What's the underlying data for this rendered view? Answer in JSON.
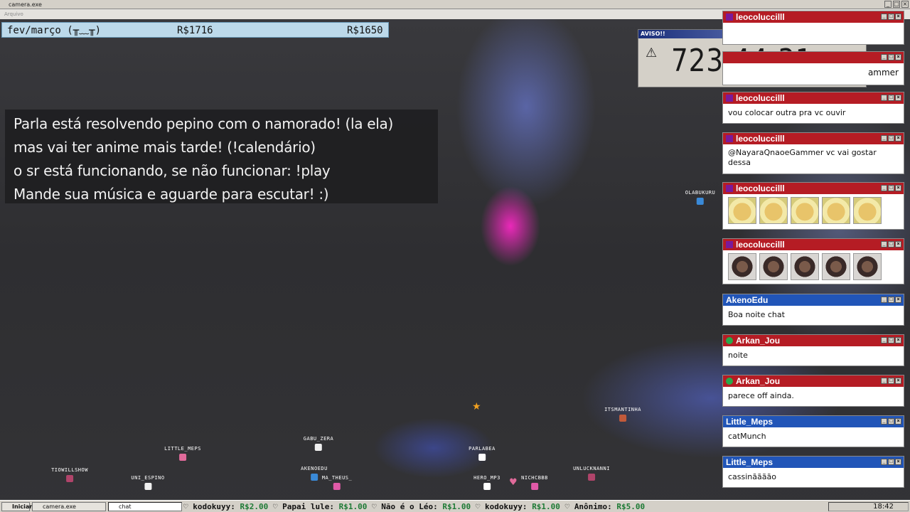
{
  "window": {
    "title": "camera.exe",
    "menu": "Arquivo"
  },
  "money_bar": {
    "label": "fev/março (╥﹏╥)",
    "value1": "R$1716",
    "value2": "R$1650"
  },
  "notice": {
    "lines": [
      "Parla está resolvendo pepino com o namorado! (la ela)",
      "mas vai ter anime mais tarde! (!calendário)",
      "o sr está funcionando, se não funcionar: !play",
      "Mande sua música e aguarde para escutar! :)"
    ]
  },
  "timer": {
    "title": "AVISO!!",
    "value": "723:44:31",
    "warn_icon": "warning-icon"
  },
  "chats": [
    {
      "user": "leocoluccilll",
      "msg": "",
      "color": "#b51c24"
    },
    {
      "user": "",
      "msg": "ammer",
      "color": "#b51c24"
    },
    {
      "user": "leocoluccilll",
      "msg": "vou colocar outra pra vc ouvir",
      "color": "#b51c24"
    },
    {
      "user": "leocoluccilll",
      "msg": "@NayaraQnaoeGammer vc vai gostar dessa",
      "color": "#b51c24"
    },
    {
      "user": "leocoluccilll",
      "emotes": "doge",
      "color": "#b51c24"
    },
    {
      "user": "leocoluccilll",
      "emotes": "face",
      "color": "#b51c24"
    },
    {
      "user": "AkenoEdu",
      "msg": "Boa noite chat",
      "color": "#2155b8"
    },
    {
      "user": "Arkan_Jou",
      "msg": "noite",
      "color": "#b51c24"
    },
    {
      "user": "Arkan_Jou",
      "msg": "parece off ainda.",
      "color": "#b51c24"
    },
    {
      "user": "Little_Meps",
      "msg": "catMunch",
      "color": "#2155b8"
    },
    {
      "user": "Little_Meps",
      "msg": "cassinãããão",
      "color": "#2155b8"
    }
  ],
  "avatars": [
    {
      "name": "TIOWILLSHOW",
      "color": "#b0446a"
    },
    {
      "name": "LITTLE_MEPS",
      "color": "#e06a9a"
    },
    {
      "name": "UNI_ESPINO",
      "color": "#f0f0f0"
    },
    {
      "name": "GABU_ZERA",
      "color": "#f0f0f0"
    },
    {
      "name": "AKENOEDU",
      "color": "#3a8ad8"
    },
    {
      "name": "MA_THEUS_",
      "color": "#e05aa8"
    },
    {
      "name": "PARLABEA",
      "color": "#ffffff"
    },
    {
      "name": "HERO_MP3",
      "color": "#ffffff"
    },
    {
      "name": "NICHCBBB",
      "color": "#e05aa8"
    },
    {
      "name": "UNLUCKNANNI",
      "color": "#b0446a"
    },
    {
      "name": "ITSMANTINHA",
      "color": "#c25a3a"
    },
    {
      "name": "OLABUKURU",
      "color": "#3a8ad8"
    }
  ],
  "taskbar": {
    "start": "Iniciar",
    "task1": "camera.exe",
    "task2": "chat",
    "ticker": [
      {
        "name": "kodokuyy:",
        "amt": "R$2.00"
      },
      {
        "name": "Papai lule:",
        "amt": "R$1.00"
      },
      {
        "name": "Não é o Léo:",
        "amt": "R$1.00"
      },
      {
        "name": "kodokuyy:",
        "amt": "R$1.00"
      },
      {
        "name": "Anônimo:",
        "amt": "R$5.00"
      }
    ],
    "clock": "18:42"
  }
}
